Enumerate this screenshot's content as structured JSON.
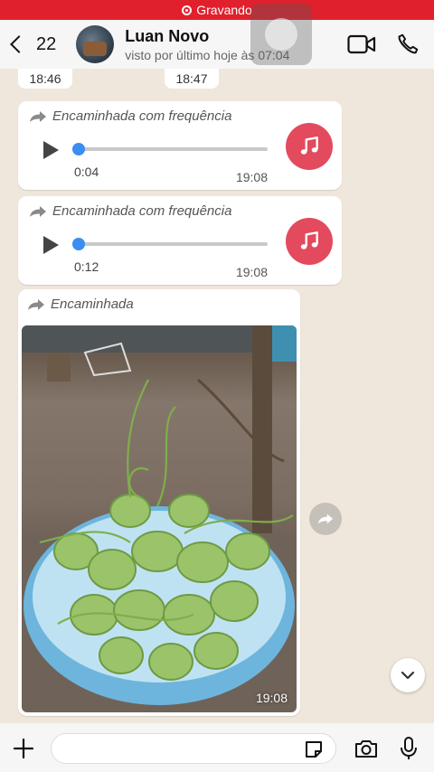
{
  "recording": {
    "label": "Gravando"
  },
  "header": {
    "back_count": "22",
    "contact_name": "Luan Novo",
    "contact_status": "visto por último hoje às 07:04"
  },
  "top_times": [
    "18:46",
    "18:47"
  ],
  "messages": [
    {
      "type": "audio",
      "forward_label": "Encaminhada com frequência",
      "duration": "0:04",
      "time": "19:08"
    },
    {
      "type": "audio",
      "forward_label": "Encaminhada com frequência",
      "duration": "0:12",
      "time": "19:08"
    },
    {
      "type": "image",
      "forward_label": "Encaminhada",
      "time": "19:08"
    }
  ],
  "colors": {
    "recording": "#e0202c",
    "accent_blue": "#3b8ef0",
    "music_icon_bg": "#e34a5e"
  }
}
